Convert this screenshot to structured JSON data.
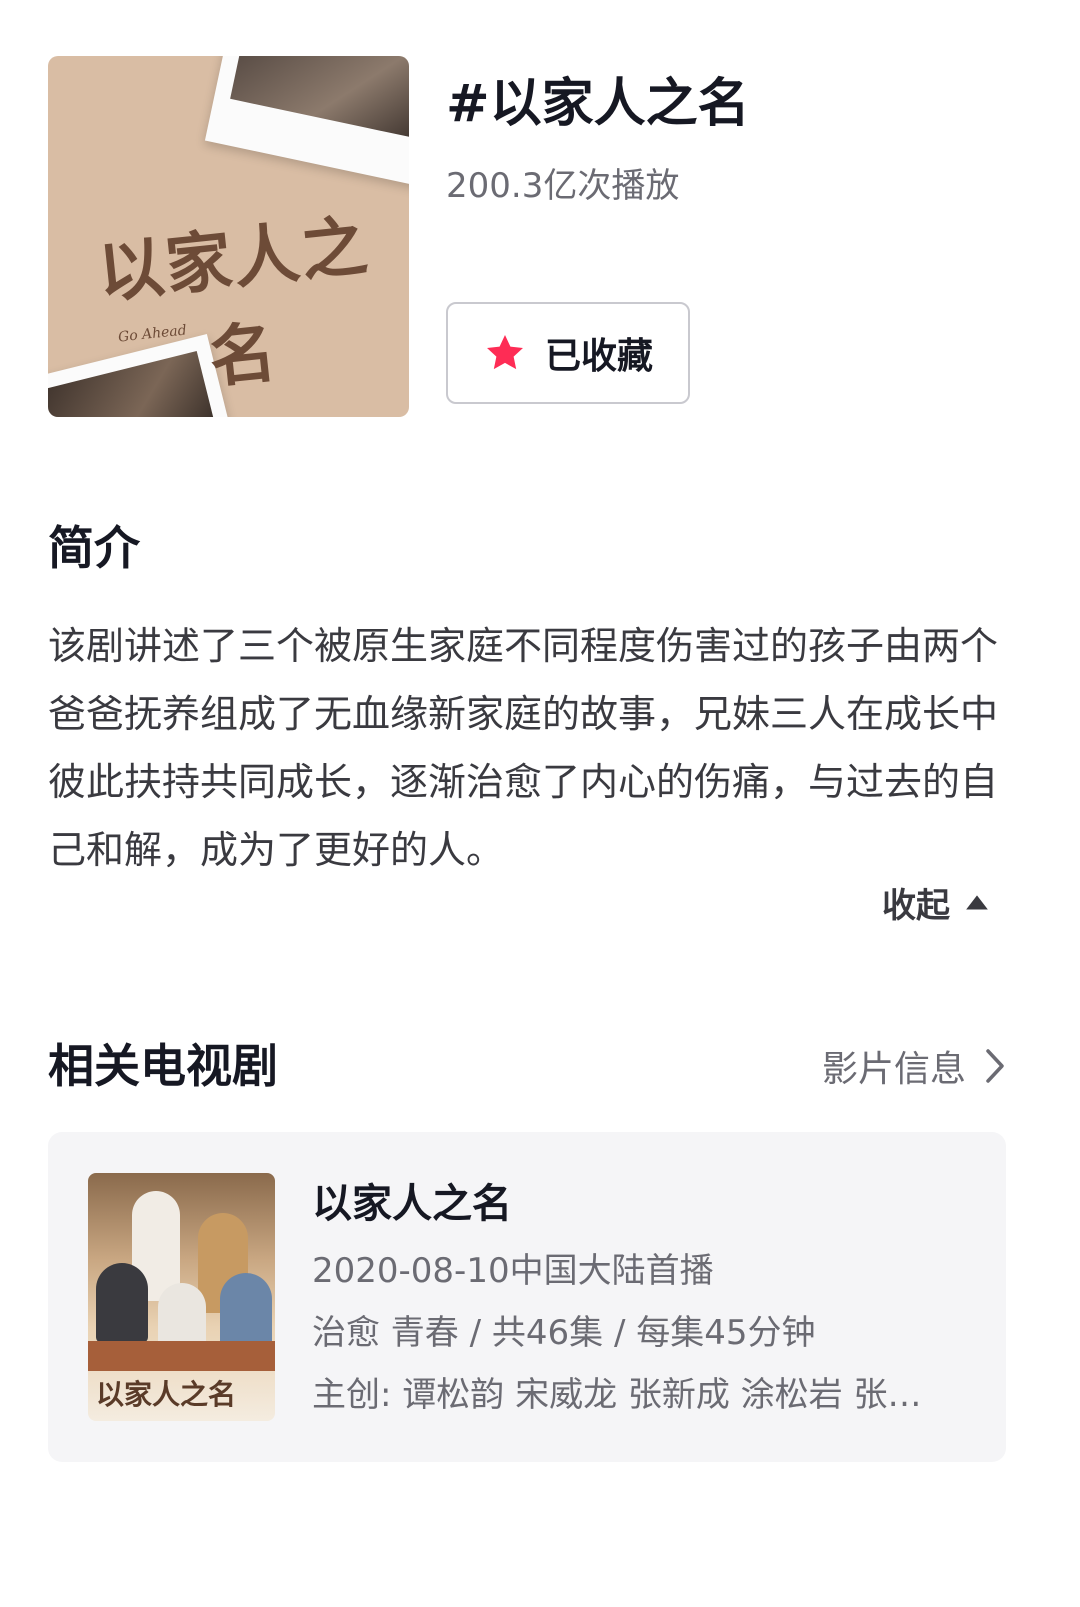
{
  "header": {
    "cover_logo_text": "以家人之名",
    "cover_logo_sub": "Go   Ahead",
    "title": "#以家人之名",
    "play_count": "200.3亿次播放",
    "favorite_label": "已收藏",
    "favorite_icon": "star-icon",
    "favorite_color": "#fe2c55"
  },
  "intro": {
    "title": "简介",
    "text": "该剧讲述了三个被原生家庭不同程度伤害过的孩子由两个爸爸抚养组成了无血缘新家庭的故事，兄妹三人在成长中彼此扶持共同成长，逐渐治愈了内心的伤痛，与过去的自己和解，成为了更好的人。",
    "collapse_label": "收起",
    "collapse_icon": "caret-up-icon"
  },
  "related": {
    "title": "相关电视剧",
    "info_link_label": "影片信息",
    "info_link_icon": "chevron-right-icon",
    "card": {
      "poster_logo": "以家人之名",
      "name": "以家人之名",
      "premiere": "2020-08-10中国大陆首播",
      "genre_line": "治愈 青春 / 共46集 / 每集45分钟",
      "cast_line": "主创: 谭松韵 宋威龙 张新成 涂松岩 张…"
    }
  }
}
